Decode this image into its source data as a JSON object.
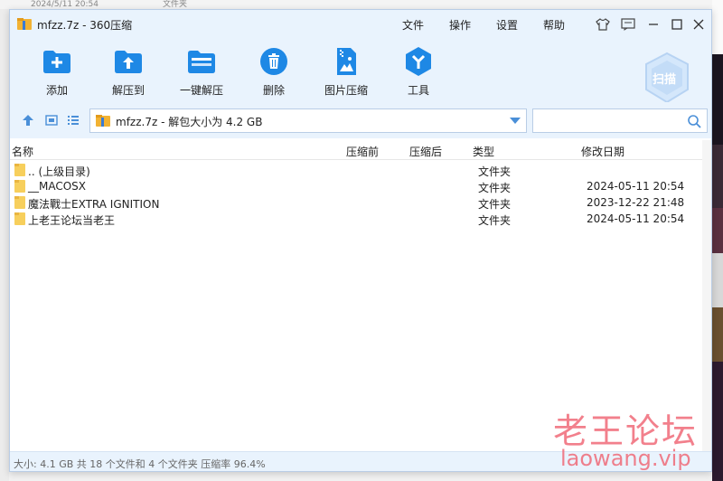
{
  "background": {
    "top_text_left": "2024/5/11 20:54",
    "top_text_right": "文件夹"
  },
  "window": {
    "title": "mfzz.7z - 360压缩",
    "menu": [
      "文件",
      "操作",
      "设置",
      "帮助"
    ],
    "controls": [
      "shirt-icon",
      "feedback-icon",
      "minimize-icon",
      "maximize-icon",
      "close-icon"
    ]
  },
  "toolbar": {
    "items": [
      {
        "label": "添加",
        "icon": "add-folder-icon"
      },
      {
        "label": "解压到",
        "icon": "extract-to-icon"
      },
      {
        "label": "一键解压",
        "icon": "one-click-extract-icon"
      },
      {
        "label": "删除",
        "icon": "delete-icon"
      },
      {
        "label": "图片压缩",
        "icon": "image-compress-icon"
      },
      {
        "label": "工具",
        "icon": "tools-icon"
      }
    ],
    "scan_label": "扫描"
  },
  "address": {
    "text": "mfzz.7z - 解包大小为 4.2 GB",
    "search_placeholder": ""
  },
  "list": {
    "columns": [
      "名称",
      "压缩前",
      "压缩后",
      "类型",
      "修改日期"
    ],
    "rows": [
      {
        "name": ".. (上级目录)",
        "type": "文件夹",
        "date": ""
      },
      {
        "name": "__MACOSX",
        "type": "文件夹",
        "date": "2024-05-11 20:54"
      },
      {
        "name": "魔法戰士EXTRA IGNITION",
        "type": "文件夹",
        "date": "2023-12-22 21:48"
      },
      {
        "name": "上老王论坛当老王",
        "type": "文件夹",
        "date": "2024-05-11 20:54"
      }
    ]
  },
  "status": "大小: 4.1 GB 共 18 个文件和 4 个文件夹 压缩率 96.4%",
  "watermark": {
    "line1": "老王论坛",
    "line2": "laowang.vip"
  },
  "colors": {
    "accent": "#1e88e5",
    "toolbar_bg": "#e9f3fd",
    "folder": "#f7cf5c",
    "watermark": "#f06a78"
  }
}
